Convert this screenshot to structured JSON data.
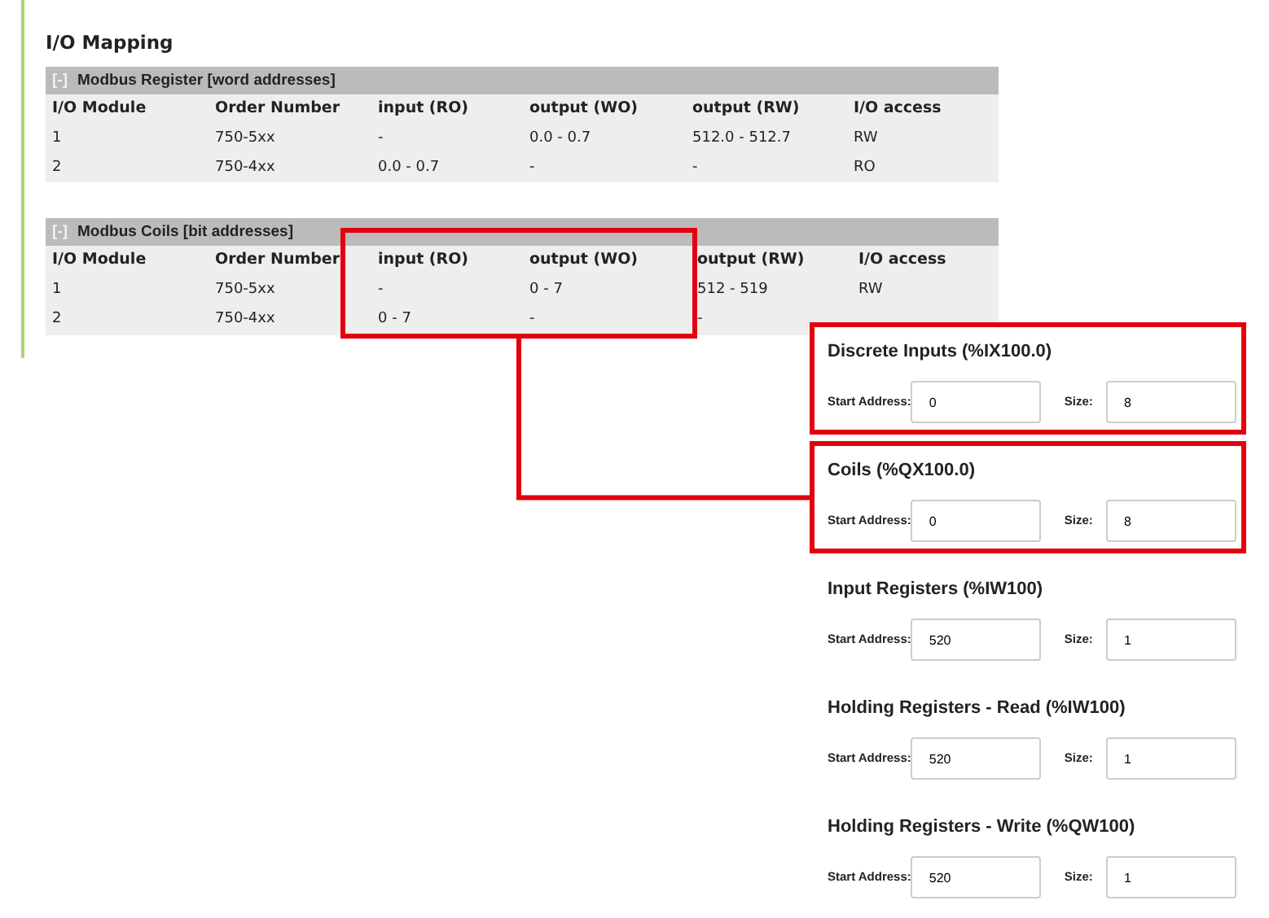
{
  "page_title": "I/O Mapping",
  "tables": [
    {
      "toggle": "[-]",
      "title": "Modbus Register [word addresses]",
      "columns": [
        {
          "label": "I/O Module",
          "highlighted": false
        },
        {
          "label": "Order Number",
          "highlighted": false
        },
        {
          "label": "input (RO)",
          "highlighted": false
        },
        {
          "label": "output (WO)",
          "highlighted": false
        },
        {
          "label": "output (RW)",
          "highlighted": false
        },
        {
          "label": "I/O access",
          "highlighted": false
        }
      ],
      "rows": [
        [
          "1",
          "750-5xx",
          "-",
          "0.0 - 0.7",
          "512.0 - 512.7",
          "RW"
        ],
        [
          "2",
          "750-4xx",
          "0.0 - 0.7",
          "-",
          "-",
          "RO"
        ]
      ]
    },
    {
      "toggle": "[-]",
      "title": "Modbus Coils [bit addresses]",
      "columns": [
        {
          "label": "I/O Module",
          "highlighted": false
        },
        {
          "label": "Order Number",
          "highlighted": false
        },
        {
          "label": "input (RO)",
          "highlighted": true
        },
        {
          "label": "output (WO)",
          "highlighted": true
        },
        {
          "label": "output (RW)",
          "highlighted": false
        },
        {
          "label": "I/O access",
          "highlighted": false
        }
      ],
      "rows": [
        [
          "1",
          "750-5xx",
          "-",
          "0 - 7",
          "512 - 519",
          "RW"
        ],
        [
          "2",
          "750-4xx",
          "0 - 7",
          "-",
          "-"
        ]
      ]
    }
  ],
  "sections": [
    {
      "title": "Discrete Inputs (%IX100.0)",
      "highlighted": true,
      "linked": false,
      "fields": [
        {
          "label": "Start Address:",
          "value": "0"
        },
        {
          "label": "Size:",
          "value": "8"
        }
      ]
    },
    {
      "title": "Coils (%QX100.0)",
      "highlighted": true,
      "linked": true,
      "fields": [
        {
          "label": "Start Address:",
          "value": "0"
        },
        {
          "label": "Size:",
          "value": "8"
        }
      ]
    },
    {
      "title": "Input Registers (%IW100)",
      "highlighted": false,
      "linked": false,
      "fields": [
        {
          "label": "Start Address:",
          "value": "520"
        },
        {
          "label": "Size:",
          "value": "1"
        }
      ]
    },
    {
      "title": "Holding Registers - Read (%IW100)",
      "highlighted": false,
      "linked": false,
      "fields": [
        {
          "label": "Start Address:",
          "value": "520"
        },
        {
          "label": "Size:",
          "value": "1"
        }
      ]
    },
    {
      "title": "Holding Registers - Write (%QW100)",
      "highlighted": false,
      "linked": false,
      "fields": [
        {
          "label": "Start Address:",
          "value": "520"
        },
        {
          "label": "Size:",
          "value": "1"
        }
      ]
    }
  ]
}
